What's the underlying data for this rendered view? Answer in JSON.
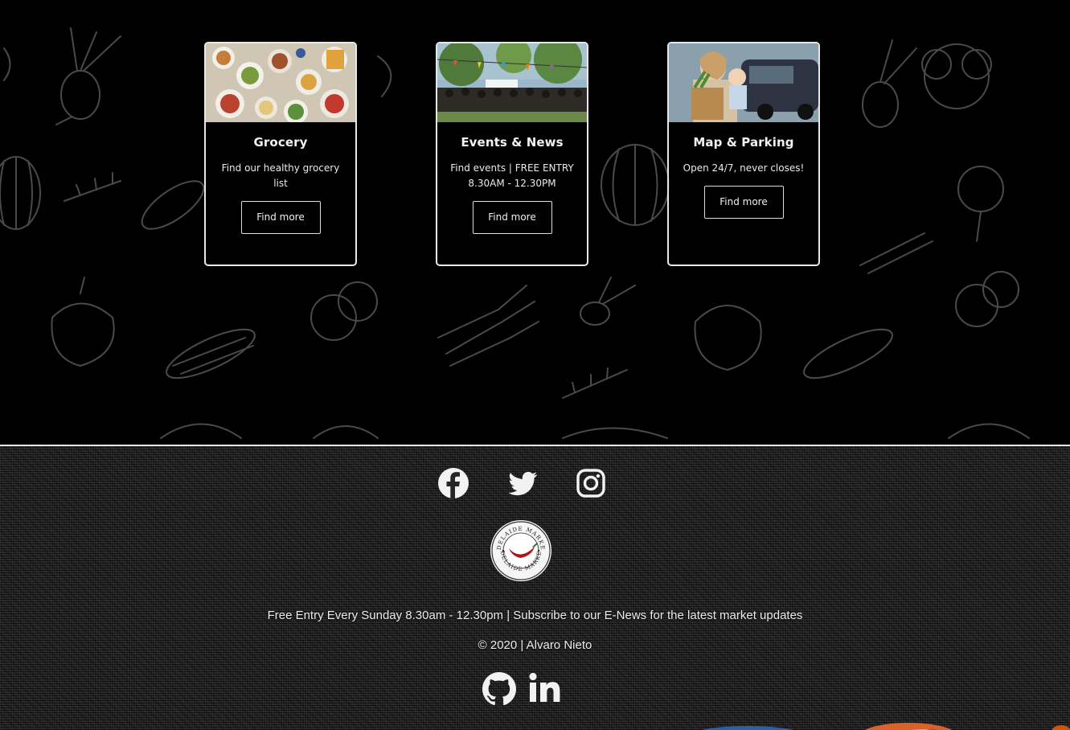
{
  "cards": [
    {
      "title": "Grocery",
      "text": "Find our healthy grocery list",
      "button": "Find more",
      "image_icon": "food-platter-photo"
    },
    {
      "title": "Events & News",
      "text": "Find events | FREE ENTRY 8.30AM - 12.30PM",
      "button": "Find more",
      "image_icon": "market-crowd-photo"
    },
    {
      "title": "Map & Parking",
      "text": "Open 24/7, never closes!",
      "button": "Find more",
      "image_icon": "woman-with-groceries-photo"
    }
  ],
  "footer": {
    "social": [
      "facebook-icon",
      "twitter-icon",
      "instagram-icon"
    ],
    "logo_text": "ADELAIDE MARKET",
    "info": "Free Entry Every Sunday 8.30am - 12.30pm | Subscribe to our E-News for the latest market updates",
    "copyright": "© 2020 | Alvaro Nieto",
    "developer_links": [
      "github-icon",
      "linkedin-icon"
    ]
  },
  "colors": {
    "background": "#000000",
    "card_border": "#e8e8e8",
    "text": "#f2f2f2",
    "chili_red": "#b3121b"
  }
}
